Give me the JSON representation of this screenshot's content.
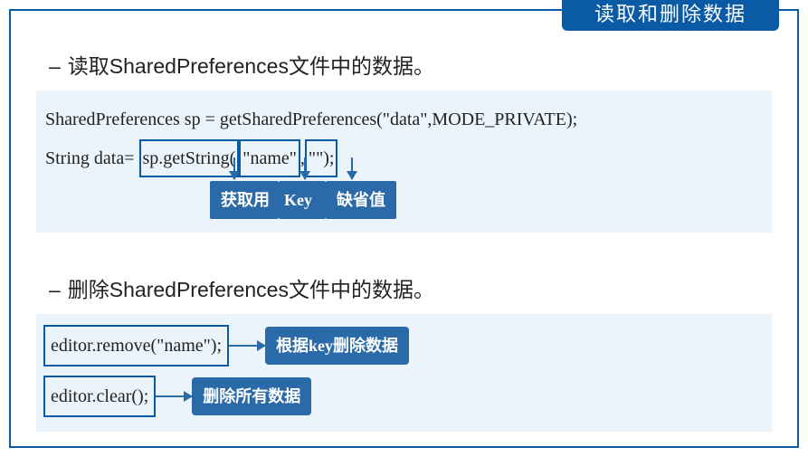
{
  "title": "读取和删除数据",
  "section1": {
    "heading": "读取SharedPreferences文件中的数据。",
    "code_line1": "SharedPreferences sp = getSharedPreferences(\"data\",MODE_PRIVATE);",
    "code_prefix": "String data=",
    "box1": "sp.getString(",
    "box2": "\"name\"",
    "sep": ",",
    "box3": "\"\");",
    "label1": "获取用",
    "label2": "Key",
    "label3": "缺省值"
  },
  "section2": {
    "heading": "删除SharedPreferences文件中的数据。",
    "code1": "editor.remove(\"name\");",
    "label1": "根据key删除数据",
    "code2": "editor.clear();",
    "label2": "删除所有数据"
  }
}
